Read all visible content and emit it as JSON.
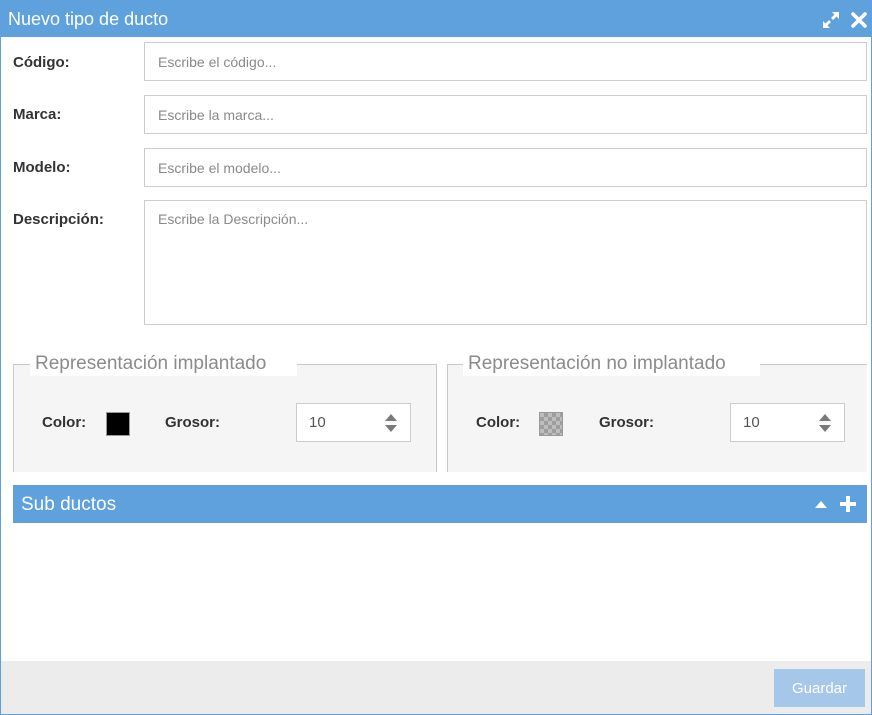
{
  "window": {
    "title": "Nuevo tipo de ducto",
    "accent_color": "#5fa1dd"
  },
  "form": {
    "codigo": {
      "label": "Código:",
      "placeholder": "Escribe el código..."
    },
    "marca": {
      "label": "Marca:",
      "placeholder": "Escribe la marca..."
    },
    "modelo": {
      "label": "Modelo:",
      "placeholder": "Escribe el modelo..."
    },
    "descripcion": {
      "label": "Descripción:",
      "placeholder": "Escribe la Descripción..."
    }
  },
  "implantado": {
    "legend": "Representación implantado",
    "color_label": "Color:",
    "color_value": "#000000",
    "grosor_label": "Grosor:",
    "grosor_value": "10"
  },
  "no_implantado": {
    "legend": "Representación no implantado",
    "color_label": "Color:",
    "color_value": "transparent",
    "grosor_label": "Grosor:",
    "grosor_value": "10"
  },
  "subductos": {
    "title": "Sub ductos"
  },
  "footer": {
    "save_label": "Guardar"
  },
  "icons": {
    "expand": "expand-icon",
    "close": "close-icon",
    "collapse": "caret-up-icon",
    "add": "plus-icon",
    "spin_up": "caret-up-icon",
    "spin_down": "caret-down-icon"
  }
}
